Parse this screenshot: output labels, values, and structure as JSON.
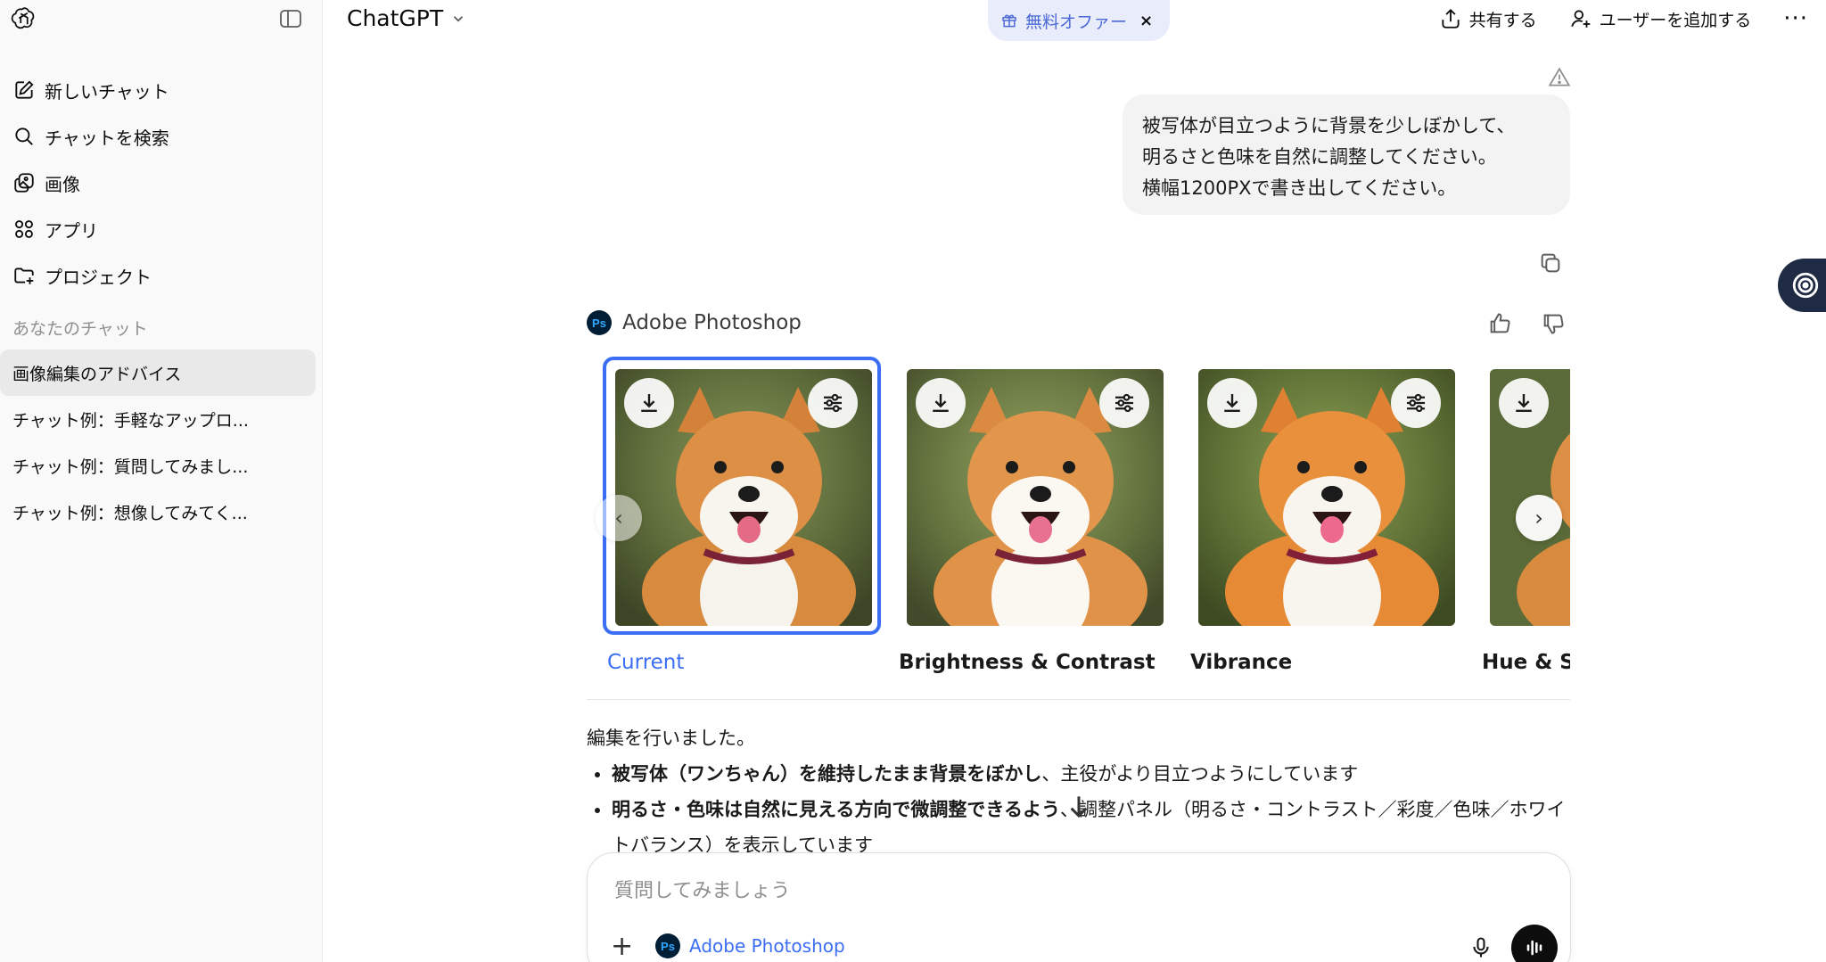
{
  "sidebar": {
    "nav": [
      {
        "label": "新しいチャット",
        "icon": "edit-icon"
      },
      {
        "label": "チャットを検索",
        "icon": "search-icon"
      },
      {
        "label": "画像",
        "icon": "images-icon"
      },
      {
        "label": "アプリ",
        "icon": "apps-icon"
      },
      {
        "label": "プロジェクト",
        "icon": "folder-plus-icon"
      }
    ],
    "section_title": "あなたのチャット",
    "chats": [
      {
        "label": "画像編集のアドバイス",
        "active": true
      },
      {
        "label": "チャット例：手軽なアップロ..."
      },
      {
        "label": "チャット例：質問してみまし..."
      },
      {
        "label": "チャット例：想像してみてく..."
      }
    ]
  },
  "header": {
    "title": "ChatGPT",
    "offer_label": "無料オファー",
    "offer_close": "×",
    "share_label": "共有する",
    "add_user_label": "ユーザーを追加する",
    "more": "···"
  },
  "conversation": {
    "user_message": {
      "lines": [
        "被写体が目立つように背景を少しぼかして、",
        "明るさと色味を自然に調整してください。",
        "横幅1200PXで書き出してください。"
      ]
    },
    "assistant": {
      "app_name": "Adobe Photoshop",
      "app_badge": "Ps",
      "cards": [
        {
          "label": "Current",
          "selected": true
        },
        {
          "label": "Brightness & Contrast"
        },
        {
          "label": "Vibrance"
        },
        {
          "label": "Hue & Saturation"
        }
      ],
      "prev_arrow": "‹",
      "next_arrow": "›",
      "intro": "編集を行いました。",
      "bullets": [
        {
          "bold": "被写体（ワンちゃん）を維持したまま背景をぼかし",
          "rest": "、主役がより目立つようにしています"
        },
        {
          "bold": "明るさ・色味は自然に見える方向で微調整できるよう",
          "rest": "、調整パネル（明るさ・コントラスト／彩度／色味／ホワイトバランス）を表示しています"
        }
      ]
    }
  },
  "composer": {
    "placeholder": "質問してみましょう",
    "plus": "+",
    "tool_label": "Adobe Photoshop",
    "tool_badge": "Ps"
  },
  "colors": {
    "accent": "#3b6ef5",
    "offer_bg": "#e8ecfb",
    "sidebar_bg": "#f9f9f9",
    "bubble_bg": "#f3f3f3"
  }
}
